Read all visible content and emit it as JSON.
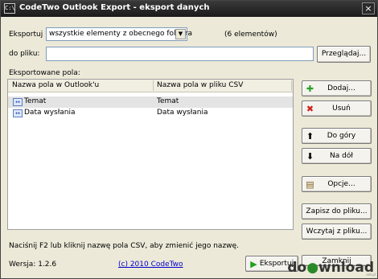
{
  "window": {
    "title": "CodeTwo Outlook Export - eksport danych",
    "app_icon_text": "C:\\",
    "close_glyph": "×"
  },
  "export_row": {
    "label": "Eksportuj",
    "selected": "wszystkie elementy z obecnego foldera",
    "count": "(6 elementów)"
  },
  "file_row": {
    "label": "do pliku:",
    "value": "",
    "browse_label": "Przeglądaj..."
  },
  "fields": {
    "group_label": "Eksportowane pola:",
    "columns": [
      "Nazwa pola w Outlook'u",
      "Nazwa pola w pliku CSV"
    ],
    "rows": [
      {
        "outlook": "Temat",
        "csv": "Temat",
        "selected": true
      },
      {
        "outlook": "Data wysłania",
        "csv": "Data wysłania",
        "selected": false
      }
    ]
  },
  "buttons": {
    "add": "Dodaj...",
    "remove": "Usuń",
    "up": "Do góry",
    "down": "Na dół",
    "options": "Opcje...",
    "save": "Zapisz do pliku...",
    "load": "Wczytaj z pliku...",
    "export": "Eksportuj",
    "close": "Zamknij"
  },
  "icons": {
    "add": "plus-icon",
    "remove": "x-icon",
    "up": "arrow-up-icon",
    "down": "arrow-down-icon",
    "options": "options-icon",
    "export": "play-icon",
    "field": "field-icon"
  },
  "colors": {
    "title_bg": "#2a2a2a",
    "window_bg": "#ece9d8",
    "add_icon": "#2aa02a",
    "remove_icon": "#d02020",
    "export_icon": "#20a020",
    "link": "#0000cc"
  },
  "footer": {
    "hint": "Naciśnij F2 lub kliknij nazwę pola CSV, aby zmienić jego nazwę.",
    "version": "Wersja: 1.2.6",
    "copyright": "(c) 2010 CodeTwo"
  },
  "watermark": {
    "brand_a": "do",
    "brand_b": "wnload",
    "brand_c": ".net.pl"
  }
}
